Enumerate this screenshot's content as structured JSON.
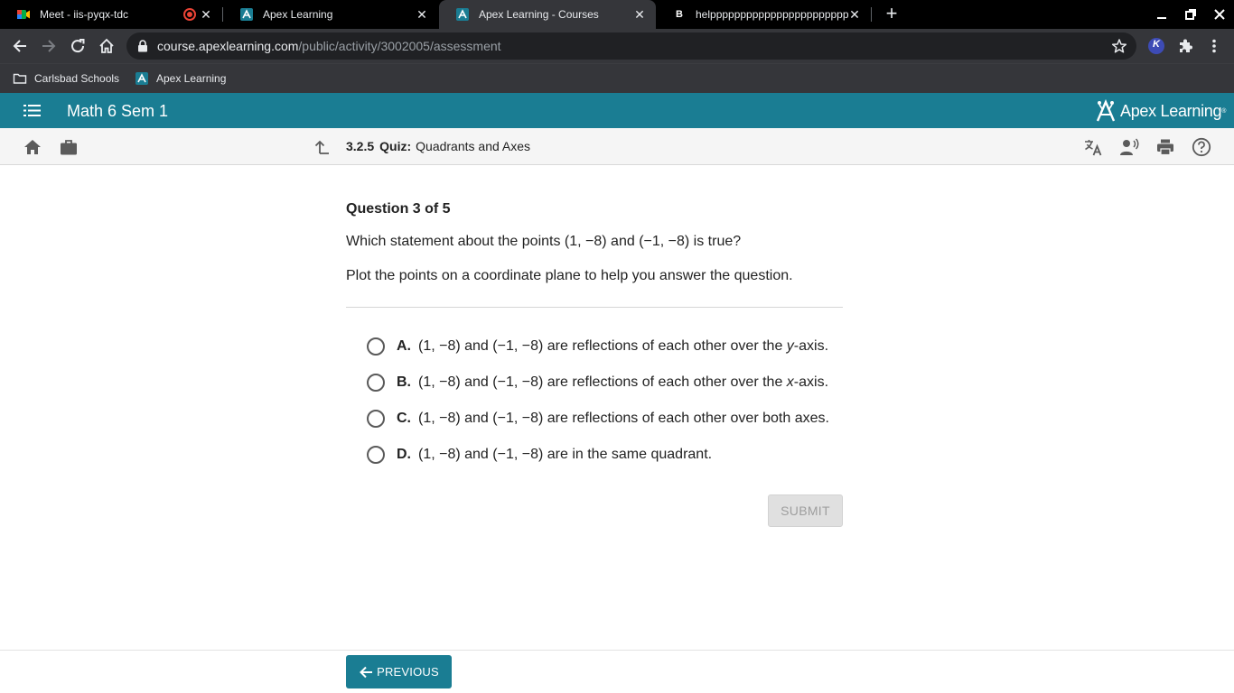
{
  "browser": {
    "tabs": [
      {
        "title": "Meet - iis-pyqx-tdc",
        "active": false
      },
      {
        "title": "Apex Learning",
        "active": false
      },
      {
        "title": "Apex Learning - Courses",
        "active": true
      },
      {
        "title": "helppppppppppppppppppppppp",
        "active": false
      }
    ],
    "url_host": "course.apexlearning.com",
    "url_path": "/public/activity/3002005/assessment",
    "bookmarks": [
      "Carlsbad Schools",
      "Apex Learning"
    ],
    "extension_letter": "K"
  },
  "app": {
    "course_title": "Math 6 Sem 1",
    "logo_text": "Apex Learning",
    "logo_mark": "®"
  },
  "breadcrumb": {
    "number": "3.2.5",
    "kind": "Quiz:",
    "name": "Quadrants and Axes"
  },
  "question": {
    "header": "Question 3 of 5",
    "text": "Which statement about the points (1, −8) and (−1, −8) is true?",
    "hint": "Plot the points on a coordinate plane to help you answer the question.",
    "options": [
      {
        "letter": "A.",
        "pre": "(1, −8) and (−1, −8) are reflections of each other over the ",
        "var": "y",
        "post": "-axis."
      },
      {
        "letter": "B.",
        "pre": "(1, −8) and (−1, −8) are reflections of each other over the ",
        "var": "x",
        "post": "-axis."
      },
      {
        "letter": "C.",
        "pre": "(1, −8) and (−1, −8) are reflections of each other over both axes.",
        "var": "",
        "post": ""
      },
      {
        "letter": "D.",
        "pre": "(1, −8) and (−1, −8) are in the same quadrant.",
        "var": "",
        "post": ""
      }
    ]
  },
  "buttons": {
    "submit": "SUBMIT",
    "previous": "PREVIOUS"
  },
  "colors": {
    "brand": "#1a7d93",
    "meet_recording": "#ea4335"
  }
}
